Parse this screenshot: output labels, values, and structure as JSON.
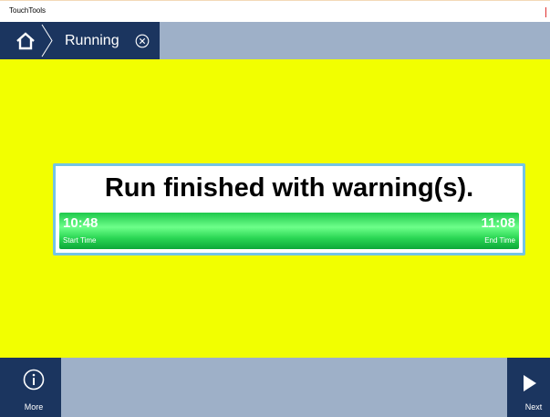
{
  "window": {
    "title": "TouchTools"
  },
  "nav": {
    "home_icon": "home-icon",
    "breadcrumb_label": "Running",
    "close_icon": "circle-x-icon"
  },
  "status": {
    "message": "Run finished with warning(s).",
    "progress": 1.0,
    "start_time": "10:48",
    "start_label": "Start Time",
    "end_time": "11:08",
    "end_label": "End Time"
  },
  "footer": {
    "more_label": "More",
    "more_icon": "info-icon",
    "next_label": "Next",
    "next_icon": "play-icon"
  },
  "colors": {
    "nav_dark": "#1b355f",
    "nav_light": "#9eb0c8",
    "main_bg": "#f2ff00",
    "progress_green": "#2ad654",
    "card_border": "#74c4e6"
  }
}
